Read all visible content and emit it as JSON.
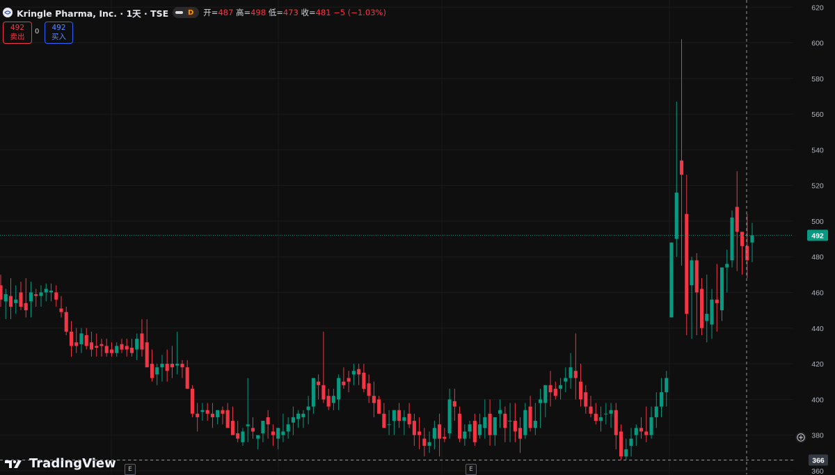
{
  "header": {
    "symbol": "Kringle Pharma, Inc. · 1天 · TSE",
    "interval_badge": "D",
    "open_label": "开=",
    "open_value": "487",
    "high_label": "高=",
    "high_value": "498",
    "low_label": "低=",
    "low_value": "473",
    "close_label": "收=",
    "close_value": "481",
    "change_value": "−5 (−1.03%)",
    "icons": {
      "logo": "kringle-logo-icon",
      "visibility": "visibility-toggle-icon"
    }
  },
  "trade": {
    "sell_price": "492",
    "sell_label": "卖出",
    "spread": "0",
    "buy_price": "492",
    "buy_label": "买入"
  },
  "price_axis": {
    "ticks": [
      "620",
      "600",
      "580",
      "560",
      "540",
      "520",
      "500",
      "480",
      "460",
      "440",
      "420",
      "400",
      "380",
      "360"
    ],
    "last_price_label": "492",
    "crosshair_price_label": "366"
  },
  "events": {
    "marker_label": "E"
  },
  "branding": {
    "name": "TradingView"
  },
  "colors": {
    "up": "#089981",
    "down": "#f23645",
    "background": "#0f0f0f",
    "grid": "#1b1b1b"
  },
  "chart_data": {
    "type": "candlestick",
    "ylim": [
      358,
      624
    ],
    "last_price": 492,
    "crosshair_price": 366,
    "ohlc": [
      [
        464,
        470,
        452,
        456
      ],
      [
        455,
        462,
        445,
        459
      ],
      [
        458,
        468,
        445,
        452
      ],
      [
        454,
        464,
        448,
        456
      ],
      [
        460,
        466,
        450,
        452
      ],
      [
        454,
        468,
        446,
        450
      ],
      [
        455,
        466,
        446,
        460
      ],
      [
        459,
        462,
        452,
        458
      ],
      [
        458,
        464,
        452,
        460
      ],
      [
        460,
        465,
        455,
        462
      ],
      [
        460,
        465,
        455,
        461
      ],
      [
        460,
        464,
        452,
        456
      ],
      [
        451,
        458,
        446,
        449
      ],
      [
        449,
        452,
        436,
        438
      ],
      [
        438,
        444,
        424,
        430
      ],
      [
        432,
        440,
        426,
        430
      ],
      [
        431,
        440,
        426,
        437
      ],
      [
        436,
        440,
        428,
        430
      ],
      [
        432,
        438,
        424,
        428
      ],
      [
        430,
        437,
        424,
        429
      ],
      [
        431,
        434,
        424,
        430
      ],
      [
        430,
        434,
        424,
        426
      ],
      [
        428,
        432,
        424,
        426
      ],
      [
        426,
        432,
        424,
        430
      ],
      [
        431,
        434,
        426,
        428
      ],
      [
        430,
        434,
        424,
        428
      ],
      [
        429,
        434,
        424,
        426
      ],
      [
        428,
        437,
        422,
        434
      ],
      [
        437,
        445,
        424,
        428
      ],
      [
        432,
        445,
        424,
        418
      ],
      [
        420,
        428,
        410,
        412
      ],
      [
        414,
        420,
        408,
        418
      ],
      [
        418,
        425,
        410,
        420
      ],
      [
        420,
        428,
        410,
        416
      ],
      [
        420,
        430,
        412,
        418
      ],
      [
        419,
        438,
        414,
        420
      ],
      [
        420,
        422,
        412,
        418
      ],
      [
        418,
        422,
        410,
        406
      ],
      [
        406,
        408,
        390,
        392
      ],
      [
        392,
        398,
        382,
        390
      ],
      [
        393,
        398,
        388,
        394
      ],
      [
        394,
        398,
        388,
        392
      ],
      [
        392,
        398,
        384,
        390
      ],
      [
        390,
        394,
        386,
        394
      ],
      [
        394,
        396,
        386,
        392
      ],
      [
        394,
        398,
        386,
        384
      ],
      [
        388,
        396,
        380,
        380
      ],
      [
        381,
        388,
        376,
        378
      ],
      [
        376,
        384,
        374,
        382
      ],
      [
        385,
        412,
        376,
        386
      ],
      [
        384,
        390,
        378,
        382
      ],
      [
        378,
        380,
        372,
        380
      ],
      [
        381,
        386,
        376,
        388
      ],
      [
        390,
        394,
        378,
        386
      ],
      [
        382,
        386,
        374,
        380
      ],
      [
        378,
        384,
        372,
        384
      ],
      [
        380,
        392,
        376,
        382
      ],
      [
        382,
        390,
        378,
        386
      ],
      [
        387,
        396,
        380,
        390
      ],
      [
        389,
        394,
        384,
        392
      ],
      [
        390,
        394,
        384,
        392
      ],
      [
        394,
        402,
        386,
        396
      ],
      [
        396,
        406,
        392,
        412
      ],
      [
        410,
        414,
        400,
        408
      ],
      [
        408,
        438,
        398,
        400
      ],
      [
        402,
        406,
        394,
        396
      ],
      [
        398,
        406,
        394,
        402
      ],
      [
        400,
        414,
        394,
        412
      ],
      [
        410,
        418,
        406,
        408
      ],
      [
        412,
        416,
        404,
        410
      ],
      [
        414,
        420,
        408,
        416
      ],
      [
        417,
        420,
        408,
        414
      ],
      [
        415,
        420,
        404,
        406
      ],
      [
        409,
        414,
        398,
        402
      ],
      [
        402,
        410,
        390,
        398
      ],
      [
        400,
        402,
        392,
        392
      ],
      [
        392,
        398,
        386,
        384
      ],
      [
        386,
        394,
        380,
        386
      ],
      [
        388,
        394,
        380,
        394
      ],
      [
        394,
        398,
        384,
        388
      ],
      [
        388,
        394,
        380,
        390
      ],
      [
        392,
        398,
        384,
        386
      ],
      [
        388,
        392,
        374,
        380
      ],
      [
        382,
        390,
        372,
        380
      ],
      [
        378,
        384,
        368,
        374
      ],
      [
        374,
        382,
        370,
        376
      ],
      [
        378,
        388,
        372,
        384
      ],
      [
        386,
        392,
        368,
        378
      ],
      [
        379,
        384,
        376,
        378
      ],
      [
        381,
        406,
        378,
        400
      ],
      [
        399,
        406,
        388,
        396
      ],
      [
        392,
        396,
        376,
        378
      ],
      [
        378,
        386,
        374,
        382
      ],
      [
        382,
        388,
        378,
        386
      ],
      [
        388,
        392,
        374,
        376
      ],
      [
        380,
        392,
        378,
        386
      ],
      [
        384,
        400,
        378,
        390
      ],
      [
        392,
        400,
        374,
        380
      ],
      [
        380,
        388,
        374,
        390
      ],
      [
        392,
        400,
        384,
        394
      ],
      [
        392,
        396,
        376,
        384
      ],
      [
        388,
        398,
        376,
        388
      ],
      [
        388,
        398,
        376,
        382
      ],
      [
        384,
        390,
        370,
        378
      ],
      [
        380,
        398,
        378,
        394
      ],
      [
        396,
        402,
        382,
        384
      ],
      [
        384,
        398,
        380,
        388
      ],
      [
        398,
        406,
        384,
        400
      ],
      [
        398,
        404,
        390,
        408
      ],
      [
        408,
        416,
        396,
        404
      ],
      [
        406,
        410,
        400,
        402
      ],
      [
        406,
        412,
        400,
        408
      ],
      [
        410,
        418,
        404,
        412
      ],
      [
        412,
        426,
        406,
        418
      ],
      [
        416,
        437,
        400,
        412
      ],
      [
        410,
        420,
        396,
        400
      ],
      [
        404,
        408,
        392,
        396
      ],
      [
        396,
        402,
        390,
        392
      ],
      [
        392,
        398,
        386,
        388
      ],
      [
        388,
        396,
        382,
        390
      ],
      [
        392,
        398,
        386,
        392
      ],
      [
        392,
        398,
        384,
        394
      ],
      [
        394,
        398,
        372,
        380
      ],
      [
        382,
        386,
        366,
        368
      ],
      [
        368,
        378,
        366,
        372
      ],
      [
        374,
        384,
        368,
        378
      ],
      [
        380,
        386,
        374,
        384
      ],
      [
        384,
        390,
        378,
        382
      ],
      [
        382,
        396,
        376,
        380
      ],
      [
        380,
        396,
        378,
        390
      ],
      [
        390,
        404,
        384,
        396
      ],
      [
        396,
        412,
        390,
        404
      ],
      [
        404,
        416,
        396,
        412
      ],
      [
        446,
        486,
        456,
        488
      ],
      [
        490,
        567,
        480,
        516
      ],
      [
        534,
        602,
        475,
        526
      ],
      [
        504,
        526,
        436,
        448
      ],
      [
        464,
        480,
        434,
        478
      ],
      [
        478,
        482,
        436,
        460
      ],
      [
        462,
        468,
        436,
        440
      ],
      [
        444,
        470,
        432,
        448
      ],
      [
        442,
        462,
        434,
        456
      ],
      [
        456,
        476,
        438,
        454
      ],
      [
        450,
        470,
        444,
        474
      ],
      [
        474,
        484,
        460,
        476
      ],
      [
        478,
        506,
        474,
        502
      ],
      [
        508,
        528,
        472,
        494
      ],
      [
        494,
        492,
        470,
        486
      ],
      [
        486,
        504,
        468,
        478
      ],
      [
        488,
        499,
        477,
        492
      ]
    ],
    "volume_axis": false
  }
}
